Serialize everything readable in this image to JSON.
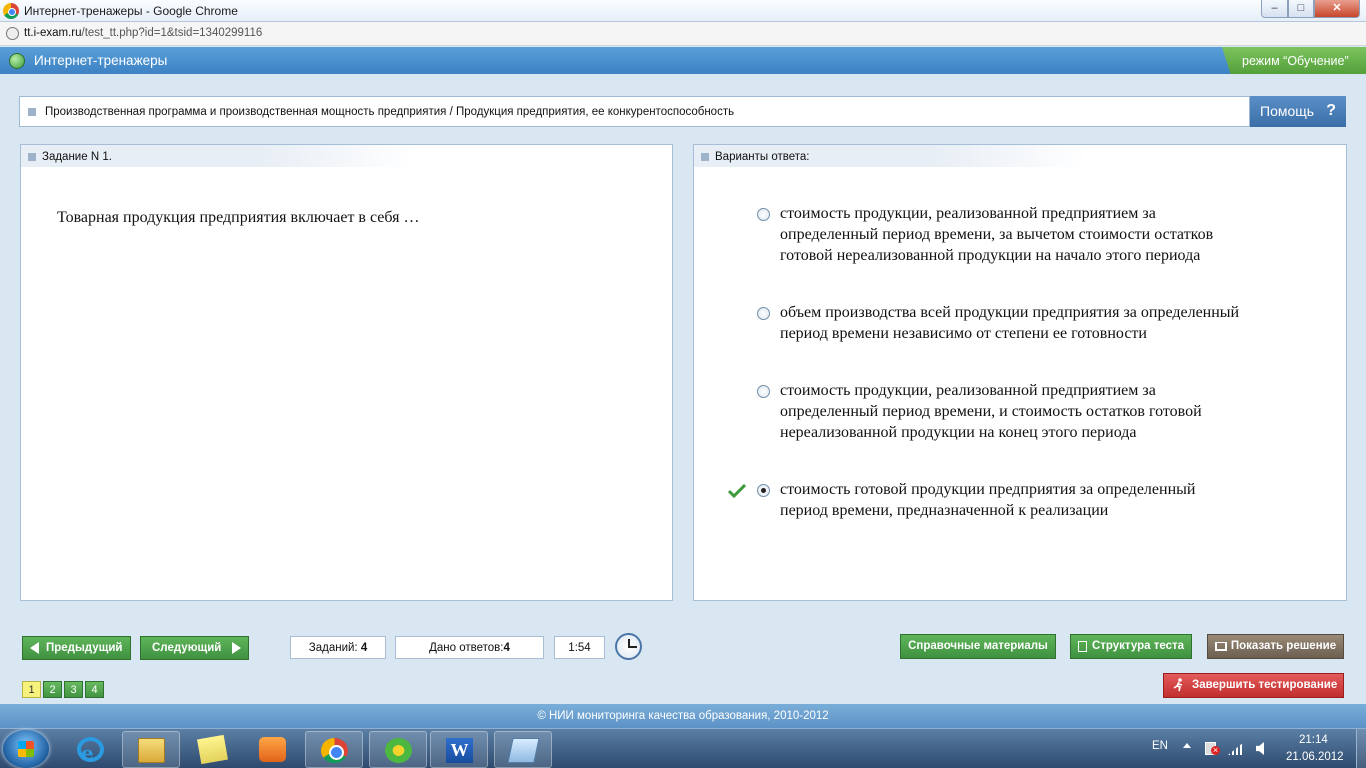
{
  "window": {
    "title": "Интернет-тренажеры - Google Chrome"
  },
  "address": {
    "host": "tt.i-exam.ru",
    "path": "/test_tt.php?id=1&tsid=1340299116"
  },
  "app": {
    "name": "Интернет-тренажеры",
    "mode": "режим “Обучение”"
  },
  "topic": "Производственная программа и производственная мощность предприятия / Продукция предприятия, ее конкурентоспособность",
  "help_label": "Помощь",
  "task": {
    "header": "Задание N 1.",
    "question": "Товарная продукция предприятия включает в себя …"
  },
  "answers": {
    "header": "Варианты ответа:",
    "options": [
      {
        "text": "стоимость продукции, реализованной предприятием за определенный период времени, за вычетом стоимости остатков готовой нереализованной продукции на начало этого периода",
        "selected": false
      },
      {
        "text": "объем производства всей продукции предприятия за определенный период времени независимо от степени ее готовности",
        "selected": false
      },
      {
        "text": "стоимость продукции, реализованной предприятием за определенный период времени, и стоимость остатков готовой нереализованной продукции на конец этого периода",
        "selected": false
      },
      {
        "text": "стоимость готовой продукции предприятия за определенный период времени, предназначенной к реализации",
        "selected": true,
        "correct": true
      }
    ]
  },
  "nav": {
    "prev": "Предыдущий",
    "next": "Следующий"
  },
  "stats": {
    "tasks_label": "Заданий:",
    "tasks": "4",
    "answers_label": "Дано ответов:",
    "answers": "4",
    "timer": "1:54"
  },
  "actions": {
    "reference": "Справочные материалы",
    "structure": "Структура теста",
    "solution": "Показать решение",
    "finish": "Завершить тестирование"
  },
  "pages": [
    {
      "label": "1",
      "current": true
    },
    {
      "label": "2"
    },
    {
      "label": "3"
    },
    {
      "label": "4"
    }
  ],
  "footer": "© НИИ мониторинга качества образования, 2010-2012",
  "taskbar": {
    "apps": [
      "internet-explorer",
      "windows-explorer",
      "sticky-notes",
      "media-player",
      "google-chrome",
      "icq",
      "microsoft-word",
      "notepad"
    ],
    "lang": "EN",
    "time": "21:14",
    "date": "21.06.2012"
  },
  "colors": {
    "header_blue": "#3c82c4",
    "mode_green": "#54a03a",
    "button_green": "#3f9140",
    "finish_red": "#c22e2e",
    "current_page_yellow": "#f6f27c"
  }
}
